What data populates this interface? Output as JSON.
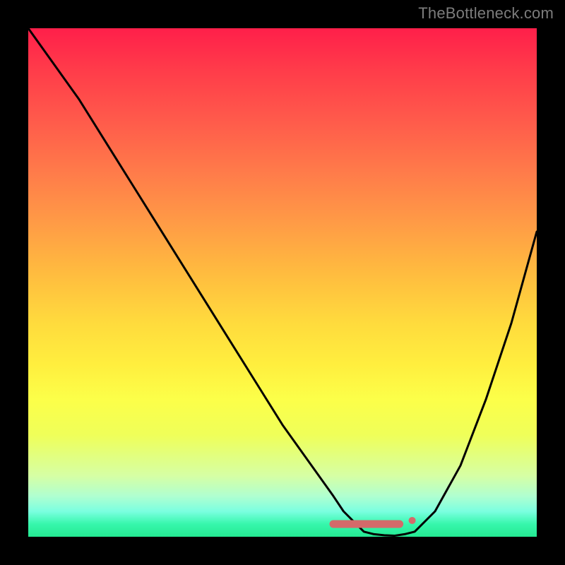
{
  "attribution": "TheBottleneck.com",
  "chart_data": {
    "type": "line",
    "title": "",
    "xlabel": "",
    "ylabel": "",
    "xlim": [
      0,
      100
    ],
    "ylim": [
      0,
      100
    ],
    "grid": false,
    "series": [
      {
        "name": "curve",
        "x": [
          0,
          5,
          10,
          15,
          20,
          25,
          30,
          35,
          40,
          45,
          50,
          55,
          60,
          62,
          64,
          66,
          68,
          70,
          72,
          74,
          76,
          80,
          85,
          90,
          95,
          100
        ],
        "y": [
          100,
          93,
          86,
          78,
          70,
          62,
          54,
          46,
          38,
          30,
          22,
          15,
          8,
          5,
          3,
          1,
          0.5,
          0.3,
          0.2,
          0.5,
          1,
          5,
          14,
          27,
          42,
          60
        ],
        "color": "#000000",
        "stroke_width": 3
      }
    ],
    "markers": [
      {
        "name": "flat-segment",
        "shape": "rounded-segment",
        "x_start": 60,
        "x_end": 73,
        "y": 2.5,
        "color": "#d46a6a",
        "thickness": 11
      },
      {
        "name": "right-dot",
        "shape": "dot",
        "x": 75.5,
        "y": 3.2,
        "color": "#d46a6a",
        "radius": 5
      }
    ]
  }
}
